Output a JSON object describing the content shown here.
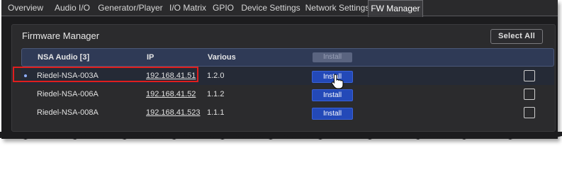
{
  "tabs": [
    {
      "label": "Overview",
      "active": false
    },
    {
      "label": "Audio I/O",
      "active": false
    },
    {
      "label": "Generator/Player",
      "active": false
    },
    {
      "label": "I/O Matrix",
      "active": false
    },
    {
      "label": "GPIO",
      "active": false
    },
    {
      "label": "Device Settings",
      "active": false
    },
    {
      "label": "Network Settings",
      "active": false
    },
    {
      "label": "FW Manager",
      "active": true
    }
  ],
  "panel": {
    "title": "Firmware Manager",
    "select_all_label": "Select All"
  },
  "table": {
    "headers": {
      "name": "NSA Audio [3]",
      "ip": "IP",
      "various": "Various",
      "install": "Install"
    },
    "rows": [
      {
        "name": "Riedel-NSA-003A",
        "ip": "192.168.41.51",
        "version": "1.2.0",
        "install_label": "Install",
        "selected": true
      },
      {
        "name": "Riedel-NSA-006A",
        "ip": "192.168.41.52",
        "version": "1.1.2",
        "install_label": "Install",
        "selected": false
      },
      {
        "name": "Riedel-NSA-008A",
        "ip": "192.168.41.523",
        "version": "1.1.1",
        "install_label": "Install",
        "selected": false
      }
    ]
  },
  "colors": {
    "accent_button": "#2349b8",
    "header_row": "#2f3a56",
    "annotation_highlight": "#e01e1e"
  },
  "icons": {
    "cursor": "hand-pointer-icon"
  }
}
